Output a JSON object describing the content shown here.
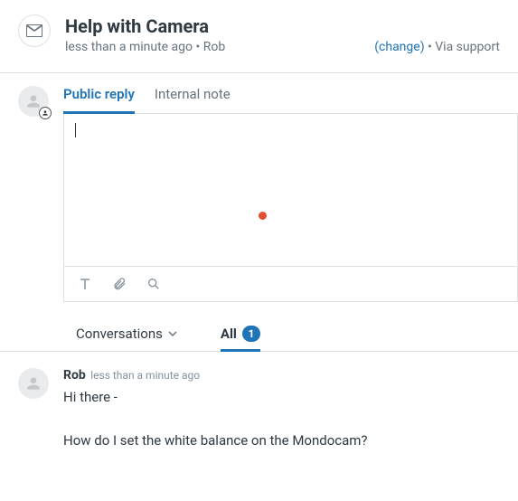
{
  "header": {
    "title": "Help with Camera",
    "timestamp": "less than a minute ago",
    "requester": "Rob",
    "change_label": "(change)",
    "channel": "Via support"
  },
  "reply": {
    "tabs": {
      "public": "Public reply",
      "internal": "Internal note"
    }
  },
  "midbar": {
    "conversations_label": "Conversations",
    "all_label": "All",
    "count": "1"
  },
  "message": {
    "author": "Rob",
    "timestamp": "less than a minute ago",
    "body_line1": "Hi there -",
    "body_line2": "How do I set the white balance on the Mondocam?"
  }
}
